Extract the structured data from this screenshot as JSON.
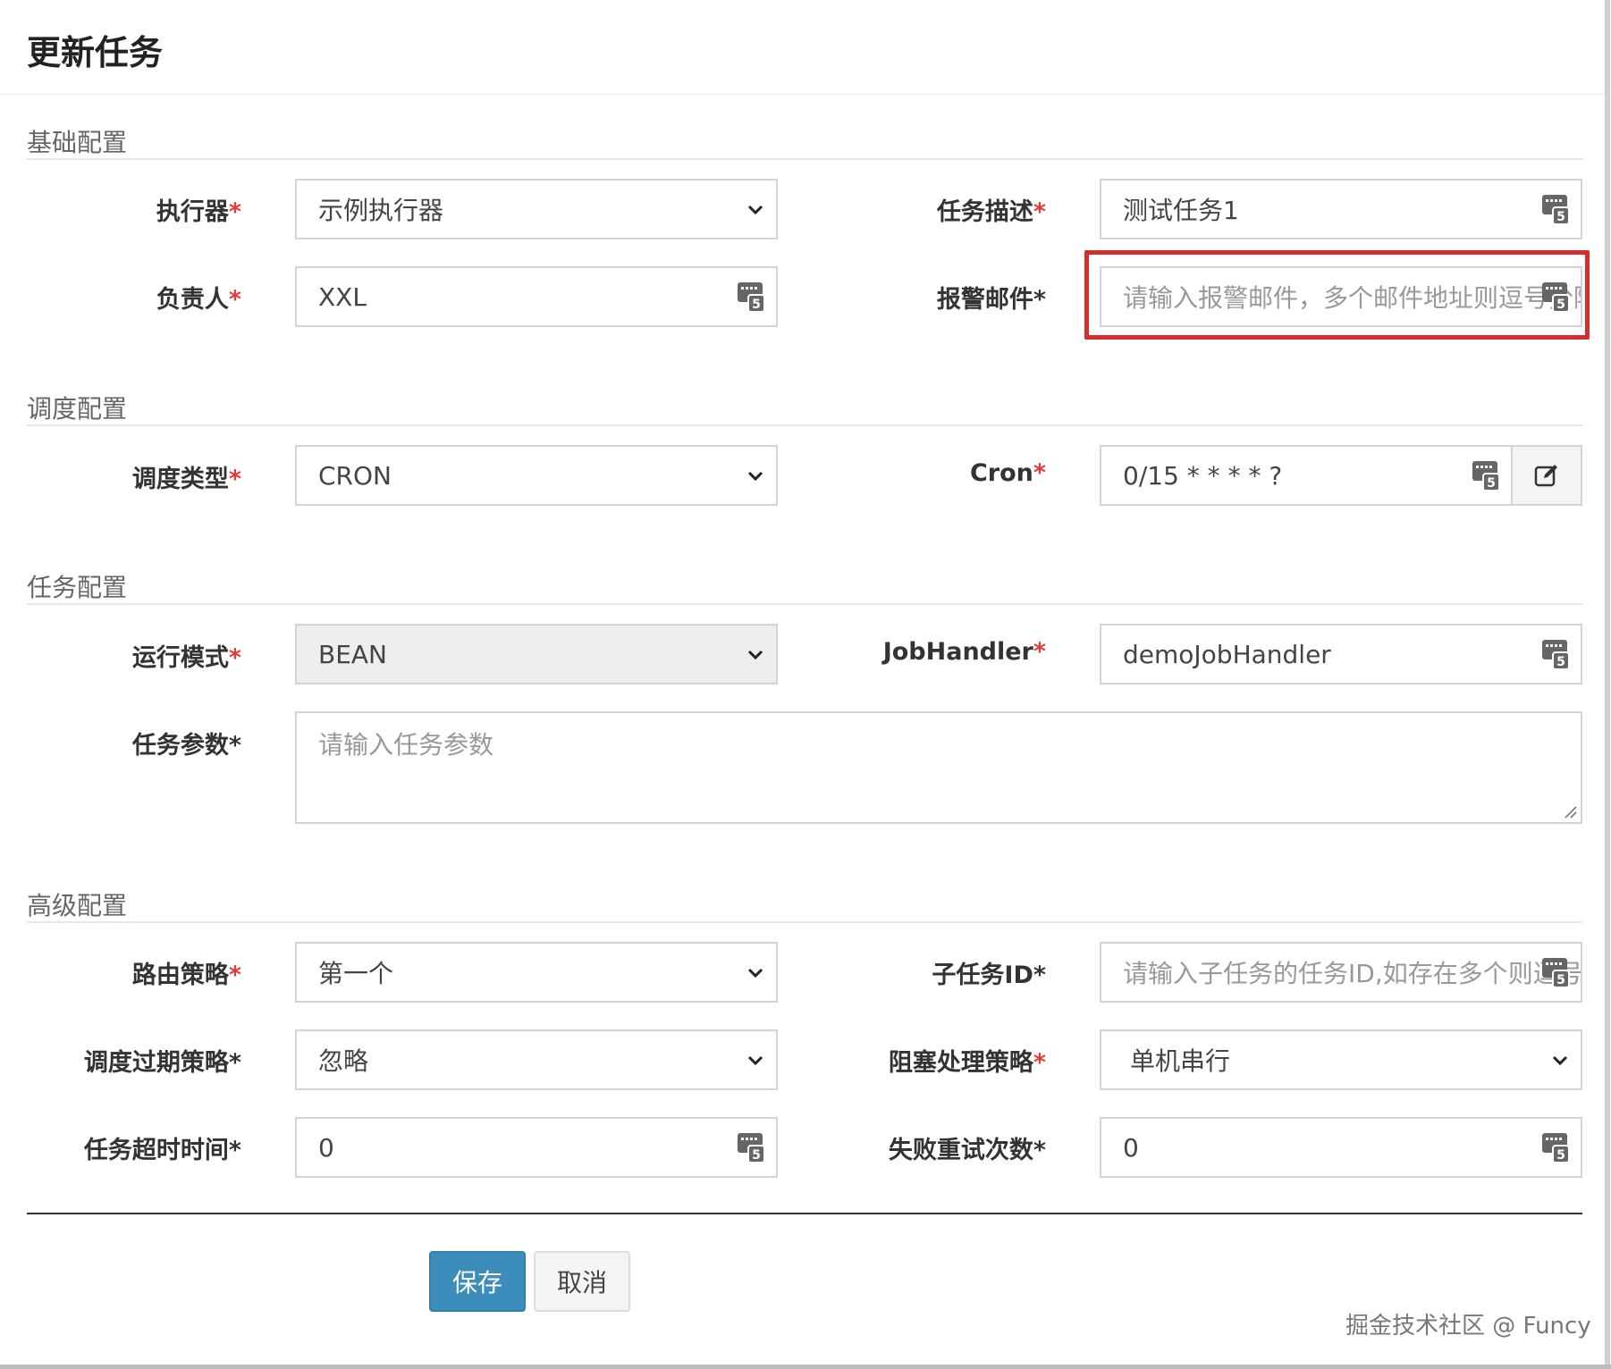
{
  "modal": {
    "title": "更新任务"
  },
  "sections": {
    "basic": "基础配置",
    "schedule": "调度配置",
    "task": "任务配置",
    "advanced": "高级配置"
  },
  "fields": {
    "executor": {
      "label": "执行器",
      "required_mark": "*",
      "value": "示例执行器"
    },
    "job_desc": {
      "label": "任务描述",
      "required_mark": "*",
      "value": "测试任务1"
    },
    "author": {
      "label": "负责人",
      "required_mark": "*",
      "value": "XXL"
    },
    "alarm_email": {
      "label": "报警邮件*",
      "placeholder": "请输入报警邮件，多个邮件地址则逗号分隔"
    },
    "schedule_type": {
      "label": "调度类型",
      "required_mark": "*",
      "value": "CRON"
    },
    "cron": {
      "label": "Cron",
      "required_mark": "*",
      "value": "0/15 * * * * ?"
    },
    "glue_type": {
      "label": "运行模式",
      "required_mark": "*",
      "value": "BEAN"
    },
    "job_handler": {
      "label": "JobHandler",
      "required_mark": "*",
      "value": "demoJobHandler"
    },
    "job_param": {
      "label": "任务参数*",
      "placeholder": "请输入任务参数"
    },
    "route_strategy": {
      "label": "路由策略",
      "required_mark": "*",
      "value": "第一个"
    },
    "child_job_id": {
      "label": "子任务ID*",
      "placeholder": "请输入子任务的任务ID,如存在多个则逗号分隔"
    },
    "misfire_strategy": {
      "label": "调度过期策略*",
      "value": "忽略"
    },
    "block_strategy": {
      "label": "阻塞处理策略",
      "required_mark": "*",
      "value": "单机串行"
    },
    "timeout": {
      "label": "任务超时时间*",
      "value": "0"
    },
    "fail_retry": {
      "label": "失败重试次数*",
      "value": "0"
    }
  },
  "buttons": {
    "save": "保存",
    "cancel": "取消"
  },
  "watermark": "掘金技术社区 @ Funcy",
  "colors": {
    "primary": "#3c8dbc",
    "required": "#e53935",
    "highlight": "#d32f2f"
  },
  "icons": {
    "input_addon": "keyboard-5-icon",
    "cron_editor": "edit-icon",
    "select": "chevron-down-icon"
  }
}
